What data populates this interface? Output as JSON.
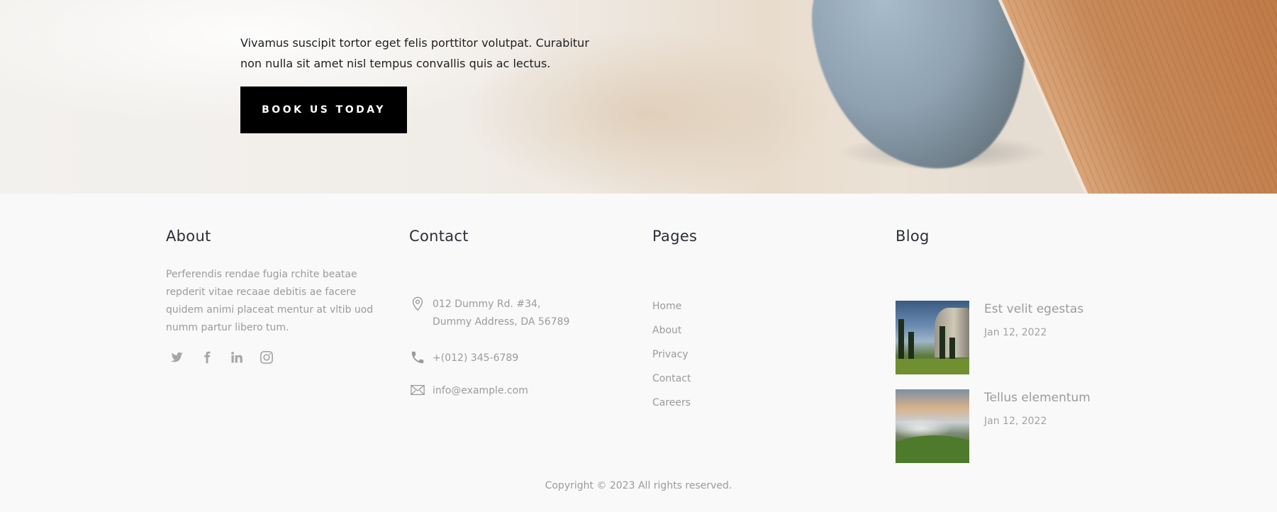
{
  "hero": {
    "text": "Vivamus suscipit tortor eget felis porttitor volutpat. Curabitur non nulla sit amet nisl tempus convallis quis ac lectus.",
    "cta_label": "BOOK US TODAY"
  },
  "footer": {
    "about": {
      "title": "About",
      "text": "Perferendis rendae fugia rchite beatae repderit vitae recaae debitis ae facere quidem animi placeat mentur at vltib uod numm partur libero tum.",
      "social_icons": [
        "twitter-icon",
        "facebook-icon",
        "linkedin-icon",
        "instagram-icon"
      ]
    },
    "contact": {
      "title": "Contact",
      "address_line1": "012 Dummy Rd. #34,",
      "address_line2": "Dummy Address, DA 56789",
      "phone": "+(012) 345-6789",
      "email": "info@example.com"
    },
    "pages": {
      "title": "Pages",
      "links": [
        "Home",
        "About",
        "Privacy",
        "Contact",
        "Careers"
      ]
    },
    "blog": {
      "title": "Blog",
      "posts": [
        {
          "title": "Est velit egestas",
          "date": "Jan 12, 2022"
        },
        {
          "title": "Tellus elementum",
          "date": "Jan 12, 2022"
        }
      ]
    },
    "copyright": "Copyright © 2023 All rights reserved."
  },
  "colors": {
    "cta_bg": "#000000",
    "muted_text": "#9b9b9b",
    "heading": "#2b2f38",
    "footer_bg": "#f9f9f9"
  }
}
